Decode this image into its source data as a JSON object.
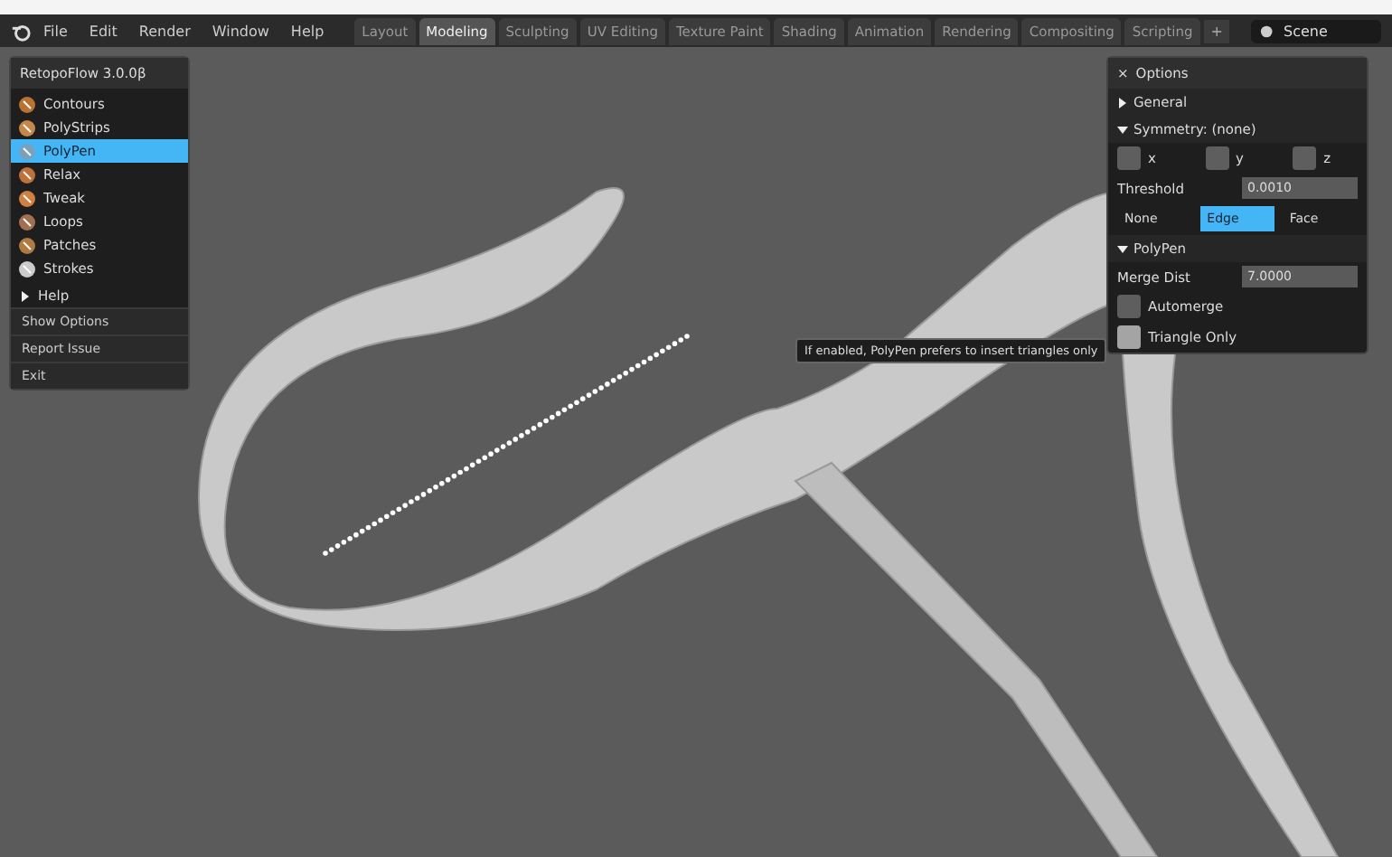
{
  "menu": [
    "File",
    "Edit",
    "Render",
    "Window",
    "Help"
  ],
  "workspaces": [
    {
      "label": "Layout",
      "selected": false
    },
    {
      "label": "Modeling",
      "selected": true
    },
    {
      "label": "Sculpting",
      "selected": false
    },
    {
      "label": "UV Editing",
      "selected": false
    },
    {
      "label": "Texture Paint",
      "selected": false
    },
    {
      "label": "Shading",
      "selected": false
    },
    {
      "label": "Animation",
      "selected": false
    },
    {
      "label": "Rendering",
      "selected": false
    },
    {
      "label": "Compositing",
      "selected": false
    },
    {
      "label": "Scripting",
      "selected": false
    }
  ],
  "add_tab": "+",
  "scene": "Scene",
  "tools_panel": {
    "title": "RetopoFlow 3.0.0β",
    "tools": [
      {
        "label": "Contours",
        "selected": false
      },
      {
        "label": "PolyStrips",
        "selected": false
      },
      {
        "label": "PolyPen",
        "selected": true
      },
      {
        "label": "Relax",
        "selected": false
      },
      {
        "label": "Tweak",
        "selected": false
      },
      {
        "label": "Loops",
        "selected": false
      },
      {
        "label": "Patches",
        "selected": false
      },
      {
        "label": "Strokes",
        "selected": false
      }
    ],
    "help": {
      "label": "Help",
      "expanded": false
    },
    "actions": [
      "Show Options",
      "Report Issue",
      "Exit"
    ]
  },
  "options": {
    "title": "Options",
    "close": "×",
    "general": {
      "label": "General",
      "expanded": false
    },
    "symmetry": {
      "label": "Symmetry: (none)",
      "expanded": true,
      "axes": [
        {
          "label": "x",
          "checked": false
        },
        {
          "label": "y",
          "checked": false
        },
        {
          "label": "z",
          "checked": false
        }
      ],
      "threshold_label": "Threshold",
      "threshold": "0.0010",
      "modes": [
        {
          "label": "None",
          "selected": false
        },
        {
          "label": "Edge",
          "selected": true
        },
        {
          "label": "Face",
          "selected": false
        }
      ]
    },
    "polypen": {
      "label": "PolyPen",
      "expanded": true,
      "merge_label": "Merge Dist",
      "merge": "7.0000",
      "toggles": [
        {
          "label": "Automerge",
          "checked": false,
          "hovered": false
        },
        {
          "label": "Triangle Only",
          "checked": false,
          "hovered": true
        }
      ]
    }
  },
  "tooltip": "If enabled, PolyPen prefers to insert triangles only"
}
